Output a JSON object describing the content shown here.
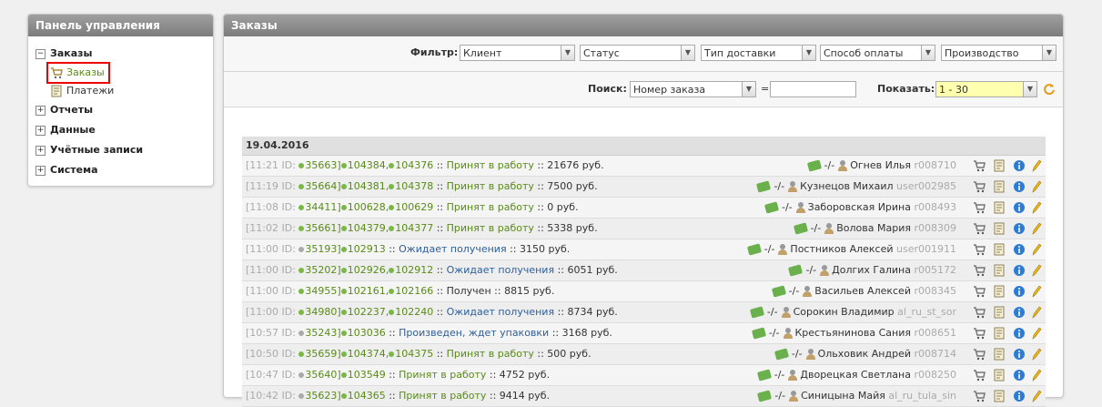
{
  "left_panel": {
    "title": "Панель управления",
    "groups": [
      {
        "label": "Заказы",
        "toggle": "−",
        "children": [
          {
            "label": "Заказы",
            "icon": "cart-icon",
            "selected": true
          },
          {
            "label": "Платежи",
            "icon": "doc-icon",
            "selected": false
          }
        ]
      },
      {
        "label": "Отчеты",
        "toggle": "+"
      },
      {
        "label": "Данные",
        "toggle": "+"
      },
      {
        "label": "Учётные записи",
        "toggle": "+"
      },
      {
        "label": "Система",
        "toggle": "+"
      }
    ]
  },
  "main": {
    "title": "Заказы",
    "filter": {
      "label": "Фильтр:",
      "client": "Клиент",
      "status": "Статус",
      "delivery": "Тип доставки",
      "payment": "Способ оплаты",
      "production": "Производство"
    },
    "search": {
      "label": "Поиск:",
      "field": "Номер заказа",
      "equals": "=",
      "value": "",
      "show_label": "Показать:",
      "show_value": "1 - 30"
    },
    "date": "19.04.2016",
    "orders": [
      {
        "time": "[11:21 ID:",
        "id": "35663]",
        "nums": [
          "104384,",
          "104376"
        ],
        "sep": "::",
        "status": "Принят в работу",
        "status_color": "green",
        "amount": ":: 21676 руб.",
        "pay": "-/-",
        "name": "Огнев Илья",
        "login": "r008710"
      },
      {
        "time": "[11:19 ID:",
        "id": "35664]",
        "nums": [
          "104381,",
          "104378"
        ],
        "sep": "::",
        "status": "Принят в работу",
        "status_color": "green",
        "amount": ":: 7500 руб.",
        "pay": "-/-",
        "name": "Кузнецов Михаил",
        "login": "user002985"
      },
      {
        "time": "[11:08 ID:",
        "id": "34411]",
        "nums": [
          "100628,",
          "100629"
        ],
        "sep": "::",
        "status": "Принят в работу",
        "status_color": "green",
        "amount": ":: 0 руб.",
        "pay": "-/-",
        "name": "Заборовская Ирина",
        "login": "r008493"
      },
      {
        "time": "[11:02 ID:",
        "id": "35661]",
        "nums": [
          "104379,",
          "104377"
        ],
        "sep": "::",
        "status": "Принят в работу",
        "status_color": "green",
        "amount": ":: 5338 руб.",
        "pay": "-/-",
        "name": "Волова Мария",
        "login": "r008309"
      },
      {
        "time": "[11:00 ID:",
        "id": "35193]",
        "nums": [
          "102913"
        ],
        "sep": "::",
        "status": "Ожидает получения",
        "status_color": "blue",
        "amount": ":: 3150 руб.",
        "pay": "-/-",
        "name": "Постников Алексей",
        "login": "user001911"
      },
      {
        "time": "[11:00 ID:",
        "id": "35202]",
        "nums": [
          "102926,",
          "102912"
        ],
        "sep": "::",
        "status": "Ожидает получения",
        "status_color": "blue",
        "amount": ":: 6051 руб.",
        "pay": "-/-",
        "name": "Долгих Галина",
        "login": "r005172"
      },
      {
        "time": "[11:00 ID:",
        "id": "34955]",
        "nums": [
          "102161,",
          "102166"
        ],
        "sep": "::",
        "status": "Получен",
        "status_color": "plain",
        "amount": ":: 8815 руб.",
        "pay": "-/-",
        "name": "Васильев Алексей",
        "login": "r008345"
      },
      {
        "time": "[11:00 ID:",
        "id": "34980]",
        "nums": [
          "102237,",
          "102240"
        ],
        "sep": "::",
        "status": "Ожидает получения",
        "status_color": "blue",
        "amount": ":: 8734 руб.",
        "pay": "-/-",
        "name": "Сорокин Владимир",
        "login": "al_ru_st_sor"
      },
      {
        "time": "[10:57 ID:",
        "id": "35243]",
        "nums": [
          "103036"
        ],
        "sep": "::",
        "status": "Произведен, ждет упаковки",
        "status_color": "blue",
        "amount": ":: 3168 руб.",
        "pay": "-/-",
        "name": "Крестьянинова Сания",
        "login": "r008651"
      },
      {
        "time": "[10:50 ID:",
        "id": "35659]",
        "nums": [
          "104374,",
          "104375"
        ],
        "sep": "::",
        "status": "Принят в работу",
        "status_color": "green",
        "amount": ":: 500 руб.",
        "pay": "-/-",
        "name": "Ольховик Андрей",
        "login": "r008714"
      },
      {
        "time": "[10:47 ID:",
        "id": "35640]",
        "nums": [
          "103549"
        ],
        "sep": "::",
        "status": "Принят в работу",
        "status_color": "green",
        "amount": ":: 4752 руб.",
        "pay": "-/-",
        "name": "Дворецкая Светлана",
        "login": "r008250"
      },
      {
        "time": "[10:42 ID:",
        "id": "35623]",
        "nums": [
          "104365"
        ],
        "sep": "::",
        "status": "Принят в работу",
        "status_color": "green",
        "amount": ":: 9414 руб.",
        "pay": "-/-",
        "name": "Синицына Майя",
        "login": "al_ru_tula_sin"
      }
    ]
  },
  "colors": {
    "accent_green": "#5a8a1a",
    "accent_blue": "#2d5f9a",
    "highlight_red": "#e00000"
  }
}
